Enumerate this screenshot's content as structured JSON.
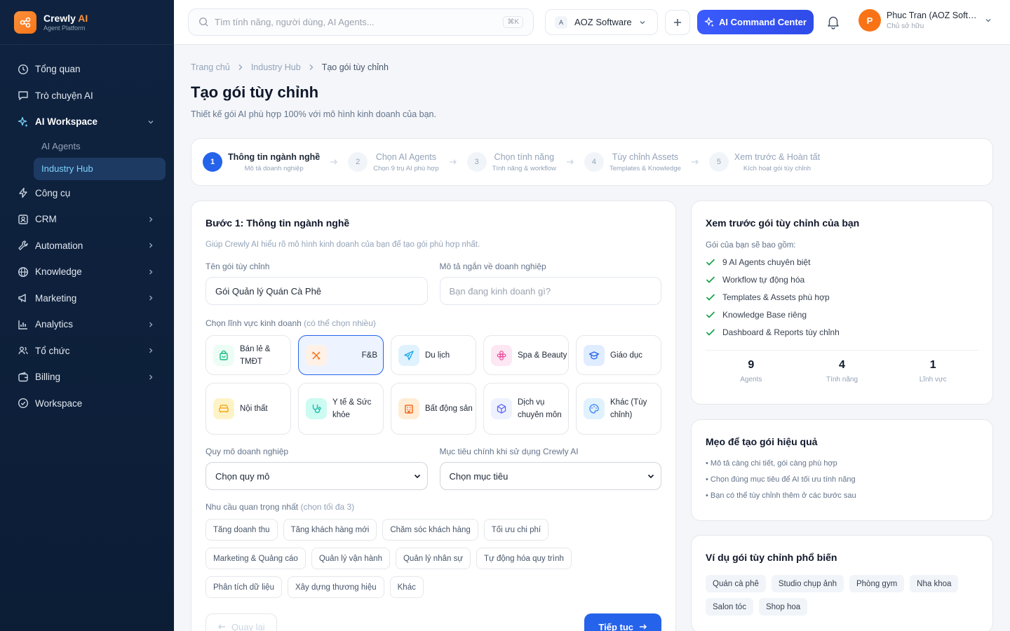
{
  "brand": {
    "name": "Crewly",
    "name_ai": "AI",
    "subtitle": "Agent Platform"
  },
  "sidebar": {
    "items": [
      {
        "label": "Tổng quan",
        "icon": "home-icon"
      },
      {
        "label": "Trò chuyện AI",
        "icon": "chat-icon"
      },
      {
        "label": "AI Workspace",
        "icon": "sparkle-icon",
        "expanded": true
      },
      {
        "label": "Công cụ",
        "icon": "bolt-icon"
      },
      {
        "label": "CRM",
        "icon": "contact-icon"
      },
      {
        "label": "Automation",
        "icon": "wrench-icon"
      },
      {
        "label": "Knowledge",
        "icon": "globe-icon"
      },
      {
        "label": "Marketing",
        "icon": "megaphone-icon"
      },
      {
        "label": "Analytics",
        "icon": "chart-icon"
      },
      {
        "label": "Tổ chức",
        "icon": "users-icon"
      },
      {
        "label": "Billing",
        "icon": "wallet-icon"
      },
      {
        "label": "Workspace",
        "icon": "check-circle-icon"
      }
    ],
    "sub_items": [
      {
        "label": "AI Agents"
      },
      {
        "label": "Industry Hub",
        "selected": true
      }
    ]
  },
  "header": {
    "search_placeholder": "Tìm tính năng, người dùng, AI Agents...",
    "search_shortcut": "⌘K",
    "org_badge": "A",
    "org_name": "AOZ Software",
    "command_label": "AI Command Center",
    "user_initial": "P",
    "user_name": "Phuc Tran (AOZ Software)",
    "user_role": "Chủ sở hữu"
  },
  "breadcrumb": [
    "Trang chủ",
    "Industry Hub",
    "Tạo gói tùy chỉnh"
  ],
  "page": {
    "title": "Tạo gói tùy chỉnh",
    "subtitle": "Thiết kế gói AI phù hợp 100% với mô hình kinh doanh của bạn."
  },
  "steps": [
    {
      "num": "1",
      "title": "Thông tin ngành nghề",
      "desc": "Mô tả doanh nghiệp"
    },
    {
      "num": "2",
      "title": "Chọn AI Agents",
      "desc": "Chọn 9 trụ AI phù hợp"
    },
    {
      "num": "3",
      "title": "Chọn tính năng",
      "desc": "Tính năng & workflow"
    },
    {
      "num": "4",
      "title": "Tùy chỉnh Assets",
      "desc": "Templates & Knowledge"
    },
    {
      "num": "5",
      "title": "Xem trước & Hoàn tất",
      "desc": "Kích hoạt gói tùy chỉnh"
    }
  ],
  "form": {
    "heading": "Bước 1: Thông tin ngành nghề",
    "description": "Giúp Crewly AI hiểu rõ mô hình kinh doanh của bạn để tạo gói phù hợp nhất.",
    "package_name_label": "Tên gói tùy chỉnh",
    "package_name_value": "Gói Quản lý Quán Cà Phê",
    "business_desc_label": "Mô tả ngắn về doanh nghiệp",
    "business_desc_placeholder": "Bạn đang kinh doanh gì?",
    "industry_label": "Chọn lĩnh vực kinh doanh",
    "industry_hint": "(có thể chọn nhiều)",
    "industries": [
      {
        "label": "Bán lẻ & TMĐT",
        "icon": "shopping-bag-icon",
        "color": "#10b981",
        "bg": "#ecfdf5"
      },
      {
        "label": "F&B",
        "icon": "utensils-icon",
        "color": "#f97316",
        "bg": "#fff1e6",
        "selected": true
      },
      {
        "label": "Du lịch",
        "icon": "plane-icon",
        "color": "#0ea5e9",
        "bg": "#e0f2fe"
      },
      {
        "label": "Spa & Beauty",
        "icon": "flower-icon",
        "color": "#ec4899",
        "bg": "#fce7f3"
      },
      {
        "label": "Giáo dục",
        "icon": "graduation-cap-icon",
        "color": "#2563eb",
        "bg": "#e0ecff"
      },
      {
        "label": "Nội thất",
        "icon": "sofa-icon",
        "color": "#f59e0b",
        "bg": "#fef3c7"
      },
      {
        "label": "Y tế & Sức khỏe",
        "icon": "stethoscope-icon",
        "color": "#14b8a6",
        "bg": "#ccfbf1"
      },
      {
        "label": "Bất động sản",
        "icon": "building-icon",
        "color": "#ea580c",
        "bg": "#ffedd5"
      },
      {
        "label": "Dịch vụ chuyên môn",
        "icon": "cube-icon",
        "color": "#6366f1",
        "bg": "#eef2ff"
      },
      {
        "label": "Khác (Tùy chỉnh)",
        "icon": "palette-icon",
        "color": "#3b82f6",
        "bg": "#e0f2fe"
      }
    ],
    "scale_label": "Quy mô doanh nghiệp",
    "scale_value": "Chọn quy mô",
    "goal_label": "Mục tiêu chính khi sử dụng Crewly AI",
    "goal_value": "Chọn mục tiêu",
    "needs_label": "Nhu cầu quan trọng nhất",
    "needs_hint": "(chọn tối đa 3)",
    "needs": [
      "Tăng doanh thu",
      "Tăng khách hàng mới",
      "Chăm sóc khách hàng",
      "Tối ưu chi phí",
      "Marketing & Quảng cáo",
      "Quản lý vận hành",
      "Quản lý nhân sự",
      "Tự động hóa quy trình",
      "Phân tích dữ liệu",
      "Xây dựng thương hiệu",
      "Khác"
    ],
    "back_label": "Quay lại",
    "next_label": "Tiếp tục"
  },
  "preview": {
    "title": "Xem trước gói tùy chỉnh của bạn",
    "lead": "Gói của bạn sẽ bao gồm:",
    "features": [
      "9 AI Agents chuyên biệt",
      "Workflow tự động hóa",
      "Templates & Assets phù hợp",
      "Knowledge Base riêng",
      "Dashboard & Reports tùy chỉnh"
    ],
    "stats": [
      {
        "value": "9",
        "label": "Agents"
      },
      {
        "value": "4",
        "label": "Tính năng"
      },
      {
        "value": "1",
        "label": "Lĩnh vực"
      }
    ]
  },
  "tips": {
    "title": "Mẹo để tạo gói hiệu quả",
    "items": [
      "• Mô tả càng chi tiết, gói càng phù hợp",
      "• Chọn đúng mục tiêu để AI tối ưu tính năng",
      "• Bạn có thể tùy chỉnh thêm ở các bước sau"
    ]
  },
  "examples": {
    "title": "Ví dụ gói tùy chỉnh phổ biến",
    "tags": [
      "Quán cà phê",
      "Studio chụp ảnh",
      "Phòng gym",
      "Nha khoa",
      "Salon tóc",
      "Shop hoa"
    ]
  },
  "colors": {
    "accent": "#2563eb",
    "brand": "#f97316",
    "sidebar": "#0f2340"
  }
}
